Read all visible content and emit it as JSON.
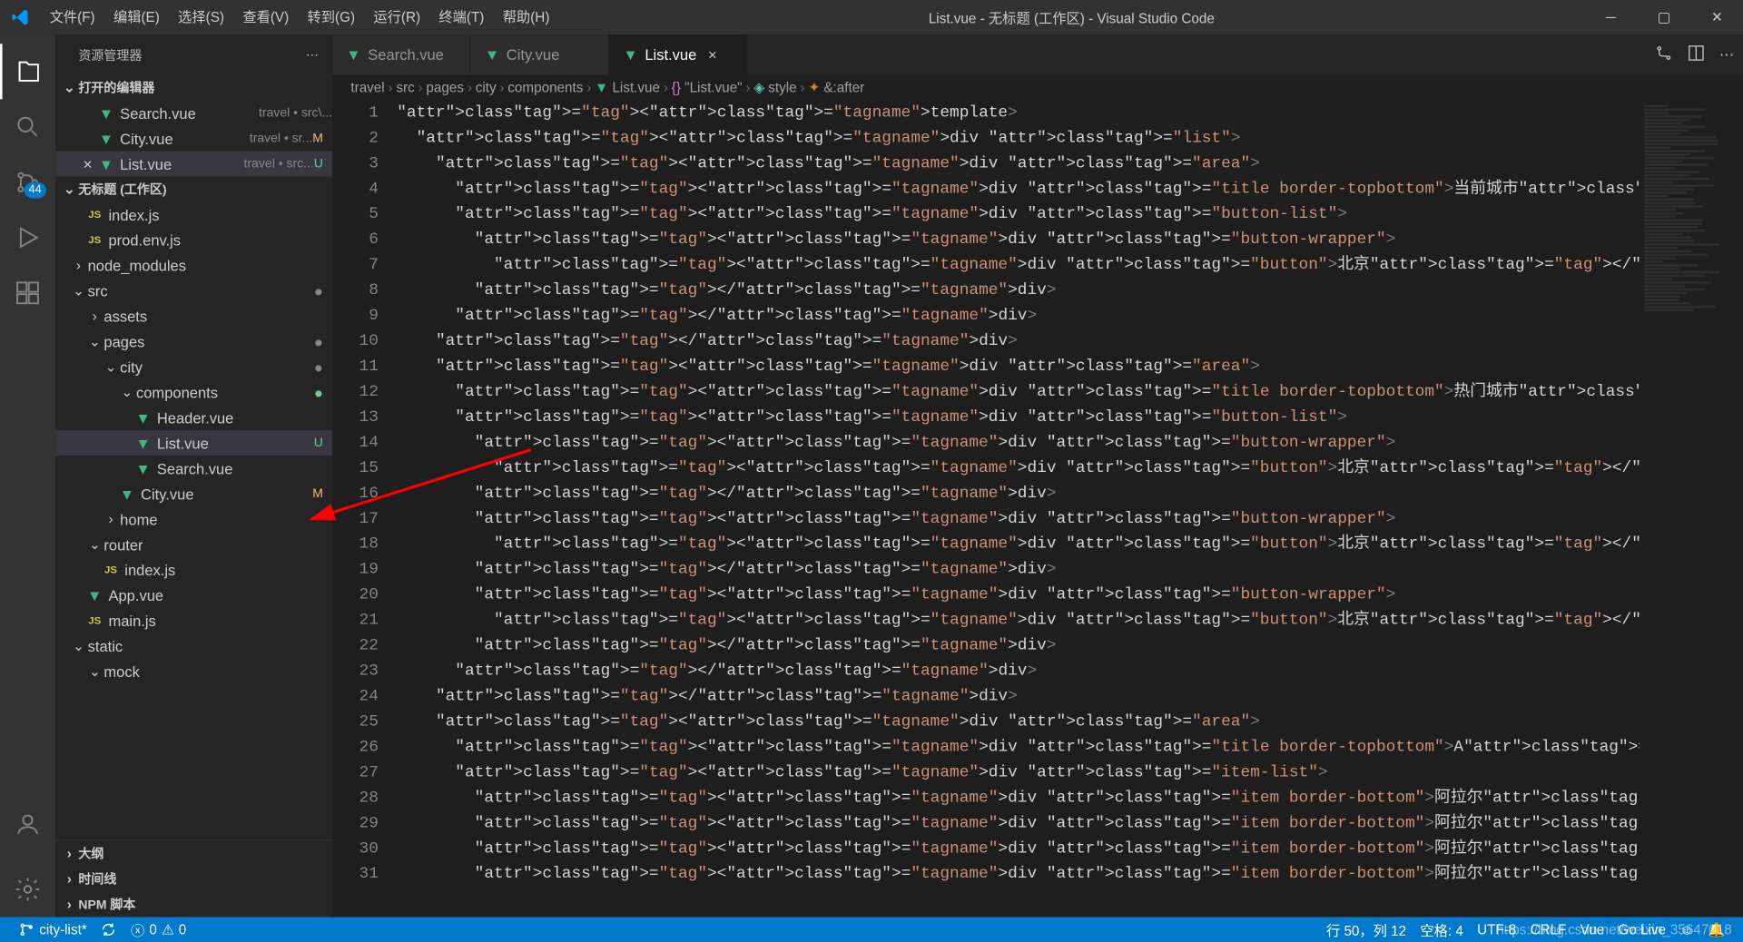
{
  "title": "List.vue - 无标题 (工作区) - Visual Studio Code",
  "menu": [
    "文件(F)",
    "编辑(E)",
    "选择(S)",
    "查看(V)",
    "转到(G)",
    "运行(R)",
    "终端(T)",
    "帮助(H)"
  ],
  "sidebar": {
    "title": "资源管理器",
    "openEditors": "打开的编辑器",
    "workspace": "无标题 (工作区)",
    "items": [
      {
        "name": "Search.vue",
        "meta": "travel • src\\...",
        "status": ""
      },
      {
        "name": "City.vue",
        "meta": "travel • sr...",
        "status": "M"
      },
      {
        "name": "List.vue",
        "meta": "travel • src...",
        "status": "U",
        "active": true
      }
    ],
    "tree": [
      {
        "indent": 1,
        "type": "file",
        "icon": "js",
        "name": "index.js"
      },
      {
        "indent": 1,
        "type": "file",
        "icon": "js",
        "name": "prod.env.js"
      },
      {
        "indent": 0,
        "type": "folder",
        "name": "node_modules",
        "chev": "›"
      },
      {
        "indent": 0,
        "type": "folder",
        "name": "src",
        "chev": "⌄",
        "dot": true
      },
      {
        "indent": 1,
        "type": "folder",
        "name": "assets",
        "chev": "›"
      },
      {
        "indent": 1,
        "type": "folder",
        "name": "pages",
        "chev": "⌄",
        "dot": true
      },
      {
        "indent": 2,
        "type": "folder",
        "name": "city",
        "chev": "⌄",
        "dot": true
      },
      {
        "indent": 3,
        "type": "folder",
        "name": "components",
        "chev": "⌄",
        "dotgreen": true
      },
      {
        "indent": 4,
        "type": "file",
        "icon": "vue",
        "name": "Header.vue"
      },
      {
        "indent": 4,
        "type": "file",
        "icon": "vue",
        "name": "List.vue",
        "status": "U",
        "active": true
      },
      {
        "indent": 4,
        "type": "file",
        "icon": "vue",
        "name": "Search.vue"
      },
      {
        "indent": 3,
        "type": "file",
        "icon": "vue",
        "name": "City.vue",
        "status": "M"
      },
      {
        "indent": 2,
        "type": "folder",
        "name": "home",
        "chev": "›"
      },
      {
        "indent": 1,
        "type": "folder",
        "name": "router",
        "chev": "⌄"
      },
      {
        "indent": 2,
        "type": "file",
        "icon": "js",
        "name": "index.js"
      },
      {
        "indent": 1,
        "type": "file",
        "icon": "vue",
        "name": "App.vue"
      },
      {
        "indent": 1,
        "type": "file",
        "icon": "js",
        "name": "main.js"
      },
      {
        "indent": 0,
        "type": "folder",
        "name": "static",
        "chev": "⌄"
      },
      {
        "indent": 1,
        "type": "folder",
        "name": "mock",
        "chev": "⌄"
      }
    ],
    "bottomSections": [
      "大纲",
      "时间线",
      "NPM 脚本"
    ]
  },
  "badge": "44",
  "tabs": [
    {
      "name": "Search.vue",
      "active": false
    },
    {
      "name": "City.vue",
      "active": false
    },
    {
      "name": "List.vue",
      "active": true
    }
  ],
  "breadcrumbs": [
    "travel",
    "src",
    "pages",
    "city",
    "components",
    "List.vue",
    "\"List.vue\"",
    "style",
    "&:after"
  ],
  "code": {
    "start": 1,
    "lines": [
      "<template>",
      "  <div class=\"list\">",
      "    <div class=\"area\">",
      "      <div class=\"title border-topbottom\">当前城市</div>",
      "      <div class=\"button-list\">",
      "        <div class=\"button-wrapper\">",
      "          <div class=\"button\">北京</div>",
      "        </div>",
      "      </div>",
      "    </div>",
      "    <div class=\"area\">",
      "      <div class=\"title border-topbottom\">热门城市</div>",
      "      <div class=\"button-list\">",
      "        <div class=\"button-wrapper\">",
      "          <div class=\"button\">北京</div>",
      "        </div>",
      "        <div class=\"button-wrapper\">",
      "          <div class=\"button\">北京</div>",
      "        </div>",
      "        <div class=\"button-wrapper\">",
      "          <div class=\"button\">北京</div>",
      "        </div>",
      "      </div>",
      "    </div>",
      "    <div class=\"area\">",
      "      <div class=\"title border-topbottom\">A</div>",
      "      <div class=\"item-list\">",
      "        <div class=\"item border-bottom\">阿拉尔</div>",
      "        <div class=\"item border-bottom\">阿拉尔</div>",
      "        <div class=\"item border-bottom\">阿拉尔</div>",
      "        <div class=\"item border-bottom\">阿拉尔</div>"
    ]
  },
  "statusbar": {
    "branch": "city-list*",
    "errors": "0",
    "warnings": "0",
    "lineCol": "行 50，列 12",
    "spaces": "空格: 4",
    "encoding": "UTF-8",
    "eol": "CRLF",
    "lang": "Vue",
    "golive": "Go Live",
    "watermark": "https://blog.csdn.net/weixin_35647018"
  }
}
